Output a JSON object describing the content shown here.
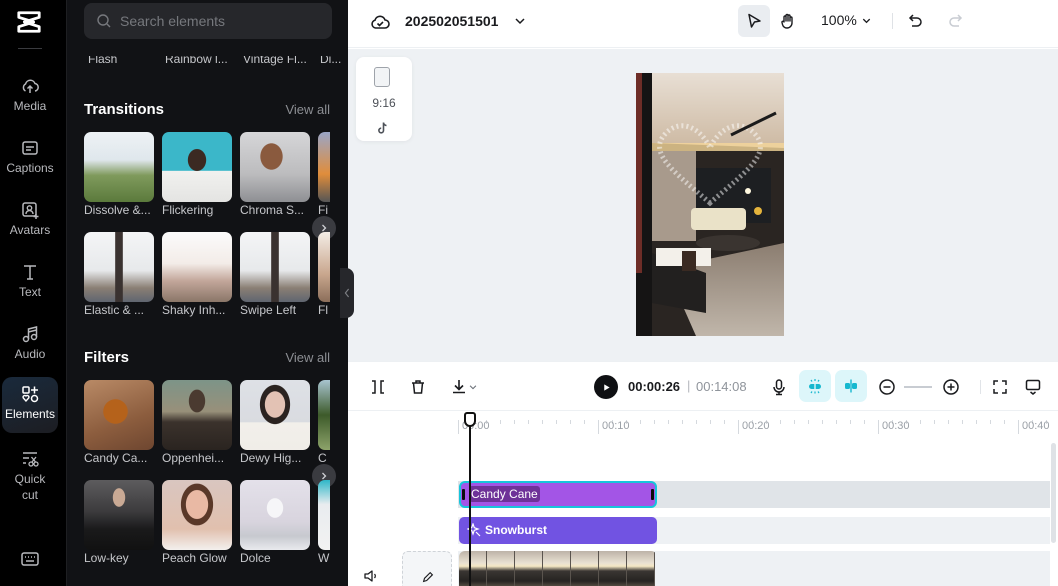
{
  "nav": {
    "items": [
      {
        "id": "media",
        "label": "Media",
        "icon": "cloud-upload-icon"
      },
      {
        "id": "captions",
        "label": "Captions",
        "icon": "captions-icon"
      },
      {
        "id": "avatars",
        "label": "Avatars",
        "icon": "avatar-icon"
      },
      {
        "id": "text",
        "label": "Text",
        "icon": "text-icon"
      },
      {
        "id": "audio",
        "label": "Audio",
        "icon": "music-note-icon"
      },
      {
        "id": "elements",
        "label": "Elements",
        "icon": "elements-icon",
        "active": true
      },
      {
        "id": "quickcut",
        "label": "Quick cut",
        "icon": "quick-cut-icon"
      }
    ]
  },
  "panel": {
    "search_placeholder": "Search elements",
    "cutoff_row": [
      "Flash",
      "Rainbow l...",
      "Vintage Fl...",
      "Di..."
    ],
    "transitions": {
      "title": "Transitions",
      "view_all": "View all",
      "items": [
        "Dissolve &...",
        "Flickering",
        "Chroma S...",
        "Fi",
        "Elastic & ...",
        "Shaky Inh...",
        "Swipe Left",
        "Fl"
      ]
    },
    "filters": {
      "title": "Filters",
      "view_all": "View all",
      "items": [
        "Candy Ca...",
        "Oppenhei...",
        "Dewy Hig...",
        "C",
        "Low-key",
        "Peach Glow",
        "Dolce",
        "W"
      ]
    }
  },
  "topbar": {
    "project_name": "202502051501",
    "zoom_level": "100%"
  },
  "canvas": {
    "aspect_ratio": "9:16"
  },
  "timeline_toolbar": {
    "current_time": "00:00:26",
    "separator": "|",
    "total_time": "00:14:08"
  },
  "timeline": {
    "ruler": [
      "00:00",
      "00:10",
      "00:20",
      "00:30",
      "00:40"
    ],
    "clips": {
      "filter": "Candy Cane",
      "effect": "Snowburst"
    }
  },
  "colors": {
    "filter_clip": "#a355e6",
    "effect_clip": "#7153e2",
    "selection_outline": "#17c5db",
    "snap_active_bg": "#ddf6fa"
  }
}
